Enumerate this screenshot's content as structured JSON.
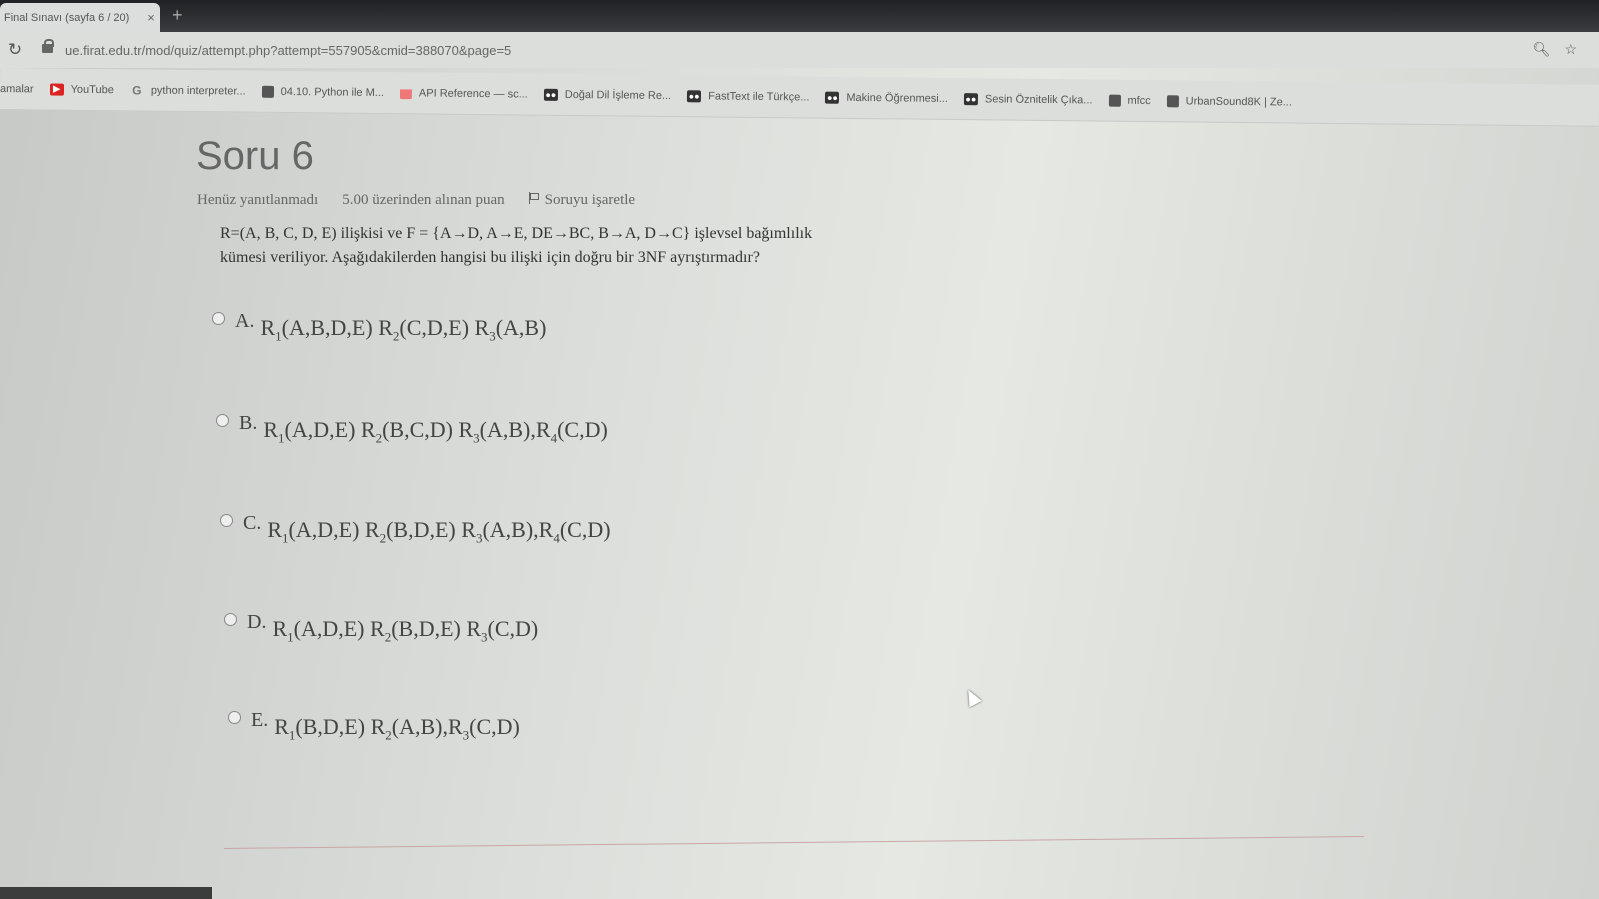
{
  "browser": {
    "tab_title": "Final Sınavı (sayfa 6 / 20)",
    "tab_close": "×",
    "new_tab": "+",
    "url": "ue.firat.edu.tr/mod/quiz/attempt.php?attempt=557905&cmid=388070&page=5",
    "bookmarks": [
      {
        "label": "amalar",
        "icon": ""
      },
      {
        "label": "YouTube",
        "icon": "youtube-icon"
      },
      {
        "label": "python interpreter...",
        "icon": "google-icon"
      },
      {
        "label": "04.10. Python ile M...",
        "icon": "globe-icon"
      },
      {
        "label": "API Reference — sc...",
        "icon": "chart-icon"
      },
      {
        "label": "Doğal Dil İşleme Re...",
        "icon": "medium-icon"
      },
      {
        "label": "FastText ile Türkçe...",
        "icon": "medium-icon"
      },
      {
        "label": "Makine Öğrenmesi...",
        "icon": "medium-icon"
      },
      {
        "label": "Sesin Öznitelik Çıka...",
        "icon": "medium-icon"
      },
      {
        "label": "mfcc",
        "icon": "globe-icon"
      },
      {
        "label": "UrbanSound8K | Ze...",
        "icon": "globe-icon"
      }
    ]
  },
  "question": {
    "title": "Soru 6",
    "status": "Henüz yanıtlanmadı",
    "points": "5.00 üzerinden alınan puan",
    "flag_label": "Soruyu işaretle",
    "text_line1": "R=(A, B, C, D, E) ilişkisi ve F = {A→D, A→E, DE→BC, B→A, D→C} işlevsel bağımlılık",
    "text_line2": "kümesi veriliyor. Aşağıdakilerden hangisi bu ilişki için doğru bir 3NF ayrıştırmadır?",
    "options": [
      {
        "letter": "A.",
        "relations": [
          {
            "sub": "1",
            "attrs": "(A,B,D,E)",
            "sep": " "
          },
          {
            "sub": "2",
            "attrs": "(C,D,E)",
            "sep": " "
          },
          {
            "sub": "3",
            "attrs": "(A,B)",
            "sep": ""
          }
        ]
      },
      {
        "letter": "B.",
        "relations": [
          {
            "sub": "1",
            "attrs": "(A,D,E)",
            "sep": " "
          },
          {
            "sub": "2",
            "attrs": "(B,C,D)",
            "sep": " "
          },
          {
            "sub": "3",
            "attrs": "(A,B),",
            "sep": ""
          },
          {
            "sub": "4",
            "attrs": "(C,D)",
            "sep": ""
          }
        ]
      },
      {
        "letter": "C.",
        "relations": [
          {
            "sub": "1",
            "attrs": "(A,D,E)",
            "sep": " "
          },
          {
            "sub": "2",
            "attrs": "(B,D,E)",
            "sep": " "
          },
          {
            "sub": "3",
            "attrs": "(A,B),",
            "sep": ""
          },
          {
            "sub": "4",
            "attrs": "(C,D)",
            "sep": ""
          }
        ]
      },
      {
        "letter": "D.",
        "relations": [
          {
            "sub": "1",
            "attrs": "(A,D,E)",
            "sep": " "
          },
          {
            "sub": "2",
            "attrs": "(B,D,E)",
            "sep": " "
          },
          {
            "sub": "3",
            "attrs": "(C,D)",
            "sep": ""
          }
        ]
      },
      {
        "letter": "E.",
        "relations": [
          {
            "sub": "1",
            "attrs": "(B,D,E)",
            "sep": " "
          },
          {
            "sub": "2",
            "attrs": "(A,B),",
            "sep": ""
          },
          {
            "sub": "3",
            "attrs": "(C,D)",
            "sep": ""
          }
        ]
      }
    ]
  }
}
